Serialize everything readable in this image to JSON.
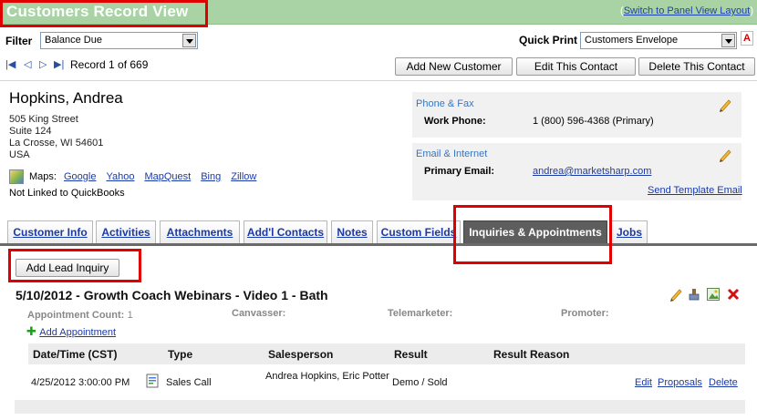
{
  "header": {
    "title": "Customers Record View",
    "switch_link": "Switch to Panel View Layout"
  },
  "filter": {
    "label": "Filter",
    "value": "Balance Due"
  },
  "quick_print": {
    "label": "Quick Print",
    "value": "Customers Envelope",
    "pdf_glyph": "A"
  },
  "nav": {
    "record_text": "Record 1 of 669"
  },
  "actions": {
    "add_customer": "Add New Customer",
    "edit_contact": "Edit This Contact",
    "delete_contact": "Delete This Contact"
  },
  "customer": {
    "name": "Hopkins, Andrea",
    "address": [
      "505 King Street",
      "Suite 124",
      "La Crosse, WI 54601",
      "USA"
    ],
    "maps_label": "Maps:",
    "map_links": [
      "Google",
      "Yahoo",
      "MapQuest",
      "Bing",
      "Zillow"
    ],
    "quickbooks_status": "Not Linked to QuickBooks"
  },
  "phone_fax": {
    "title": "Phone & Fax",
    "label": "Work Phone:",
    "value": "1 (800) 596-4368 (Primary)"
  },
  "email": {
    "title": "Email & Internet",
    "label": "Primary Email:",
    "value": "andrea@marketsharp.com",
    "send_link": "Send Template Email"
  },
  "tabs": [
    "Customer Info",
    "Activities",
    "Attachments",
    "Add'l Contacts",
    "Notes",
    "Custom Fields",
    "Inquiries & Appointments",
    "Jobs"
  ],
  "inquiry": {
    "add_button": "Add Lead Inquiry",
    "title": "5/10/2012 - Growth Coach Webinars - Video 1 - Bath",
    "appointment_count_label": "Appointment Count:",
    "appointment_count": "1",
    "canvasser_label": "Canvasser:",
    "telemarketer_label": "Telemarketer:",
    "promoter_label": "Promoter:",
    "add_appointment": "Add Appointment"
  },
  "table": {
    "columns": [
      "Date/Time (CST)",
      "Type",
      "Salesperson",
      "Result",
      "Result Reason"
    ],
    "rows": [
      {
        "datetime": "4/25/2012 3:00:00 PM",
        "type": "Sales Call",
        "salesperson": "Andrea Hopkins, Eric Potter",
        "result": "Demo / Sold",
        "result_reason": "",
        "links": [
          "Edit",
          "Proposals",
          "Delete"
        ]
      }
    ]
  },
  "colors": {
    "title_bar": "#a9d3a4",
    "highlight_box": "#e00000",
    "active_tab": "#5e5e5e",
    "link": "#1a3aa8",
    "box_title": "#3a76c0"
  }
}
